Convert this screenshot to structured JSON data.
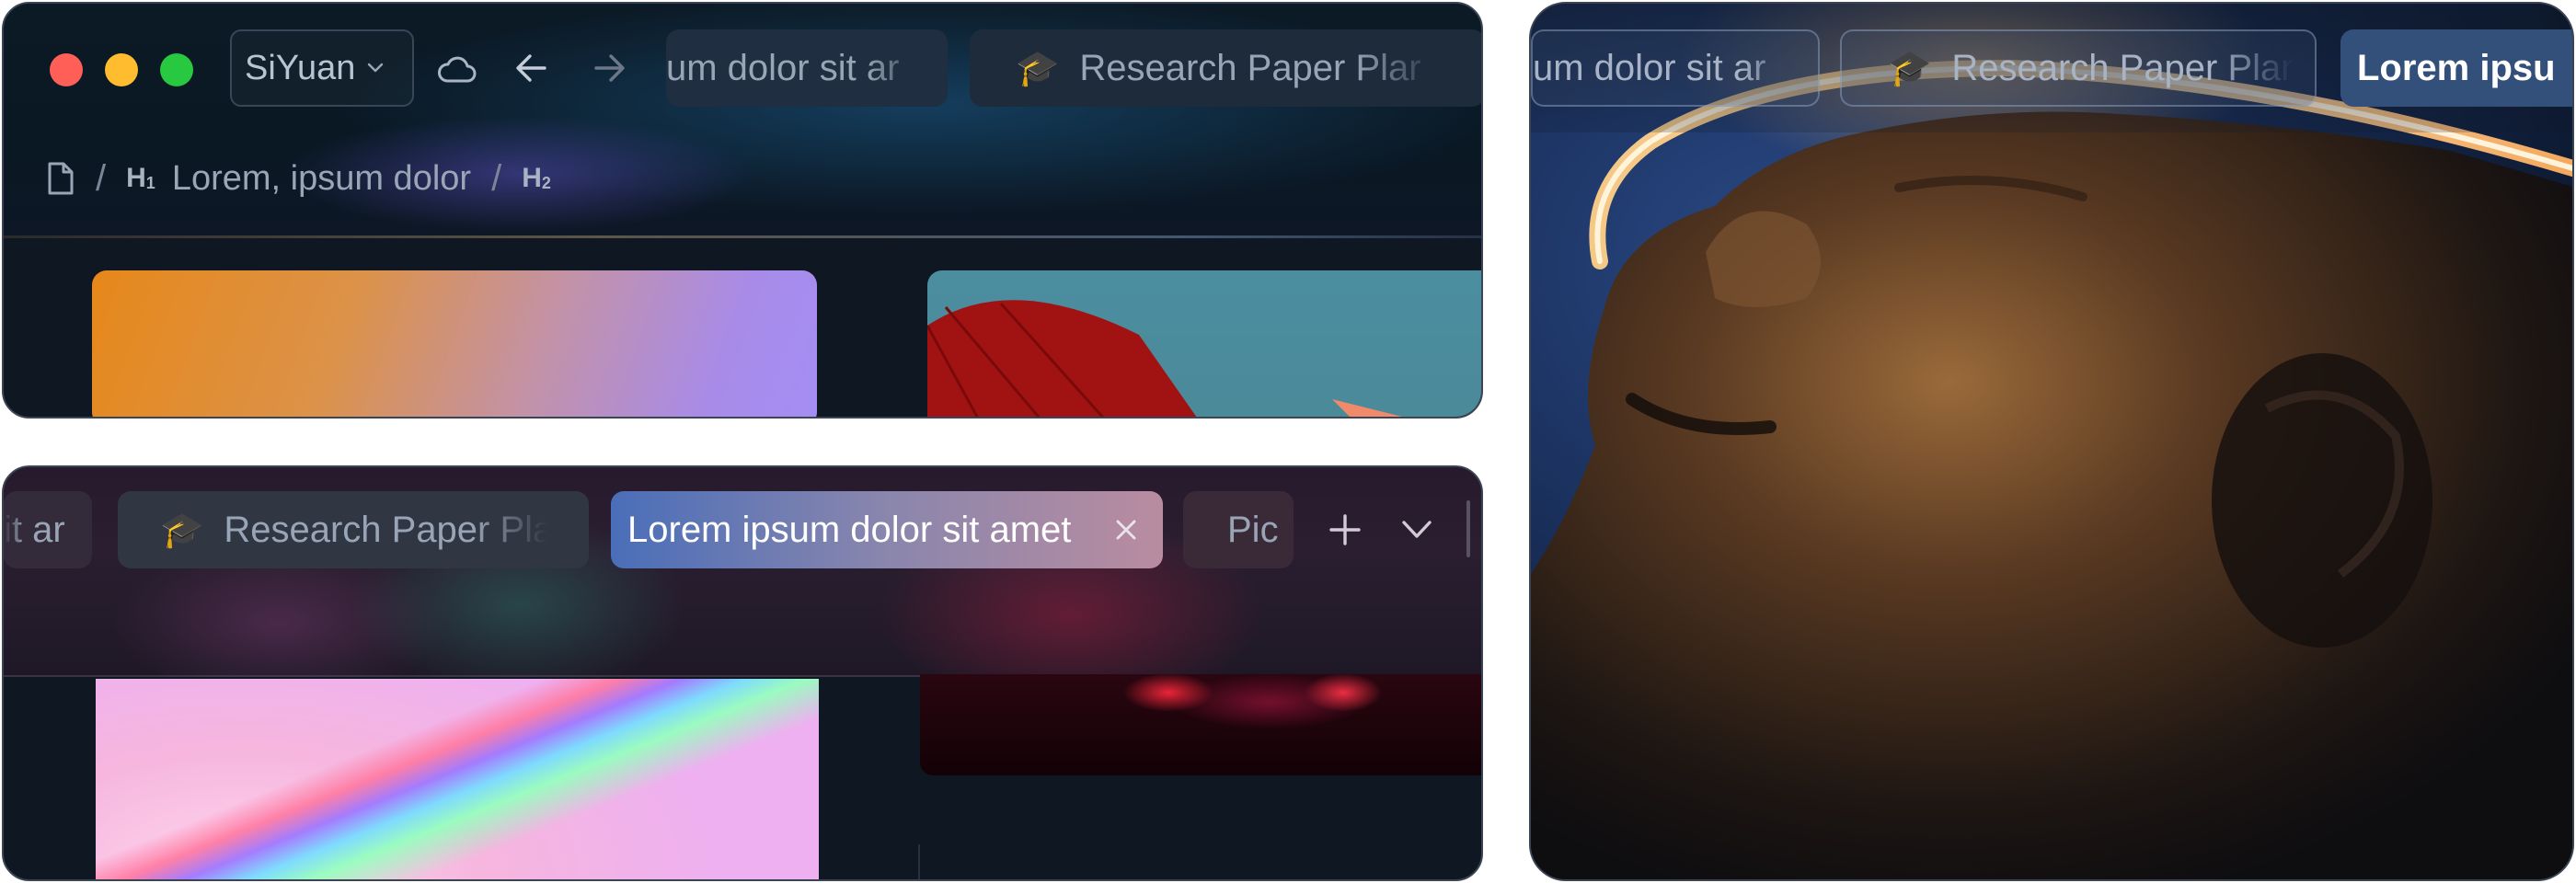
{
  "window_a": {
    "workspace_name": "SiYuan",
    "tabs": [
      {
        "label": "um dolor sit ar",
        "icon": "none"
      },
      {
        "label": "Research Paper Plar",
        "icon": "🎓"
      }
    ],
    "breadcrumb": {
      "heading1_marker": "H",
      "heading1_level": "1",
      "heading1_text": "Lorem, ipsum dolor",
      "heading2_marker": "H",
      "heading2_level": "2"
    }
  },
  "window_b": {
    "tabs": [
      {
        "label": "it ar",
        "icon": "none"
      },
      {
        "label": "Research Paper Plar",
        "icon": "🎓"
      },
      {
        "label": "Lorem ipsum dolor sit amet",
        "icon": "none",
        "active": true
      },
      {
        "label": "Pic",
        "icon": "none"
      }
    ]
  },
  "window_c": {
    "tabs": [
      {
        "label": "um dolor sit ar",
        "icon": "none"
      },
      {
        "label": "Research Paper Plar",
        "icon": "🎓"
      },
      {
        "label": "Lorem ipsu",
        "icon": "none",
        "active": true
      }
    ]
  },
  "colors": {
    "traffic_red": "#ff5f57",
    "traffic_yellow": "#febc2e",
    "traffic_green": "#28c840",
    "active_tab_blue": "#4a6eb9",
    "active_tab_pink": "#b98ca0"
  },
  "icons": [
    "file-icon",
    "cloud-icon",
    "back-arrow-icon",
    "forward-arrow-icon",
    "chevron-down-icon",
    "close-icon",
    "plus-icon",
    "graduation-cap-icon"
  ]
}
